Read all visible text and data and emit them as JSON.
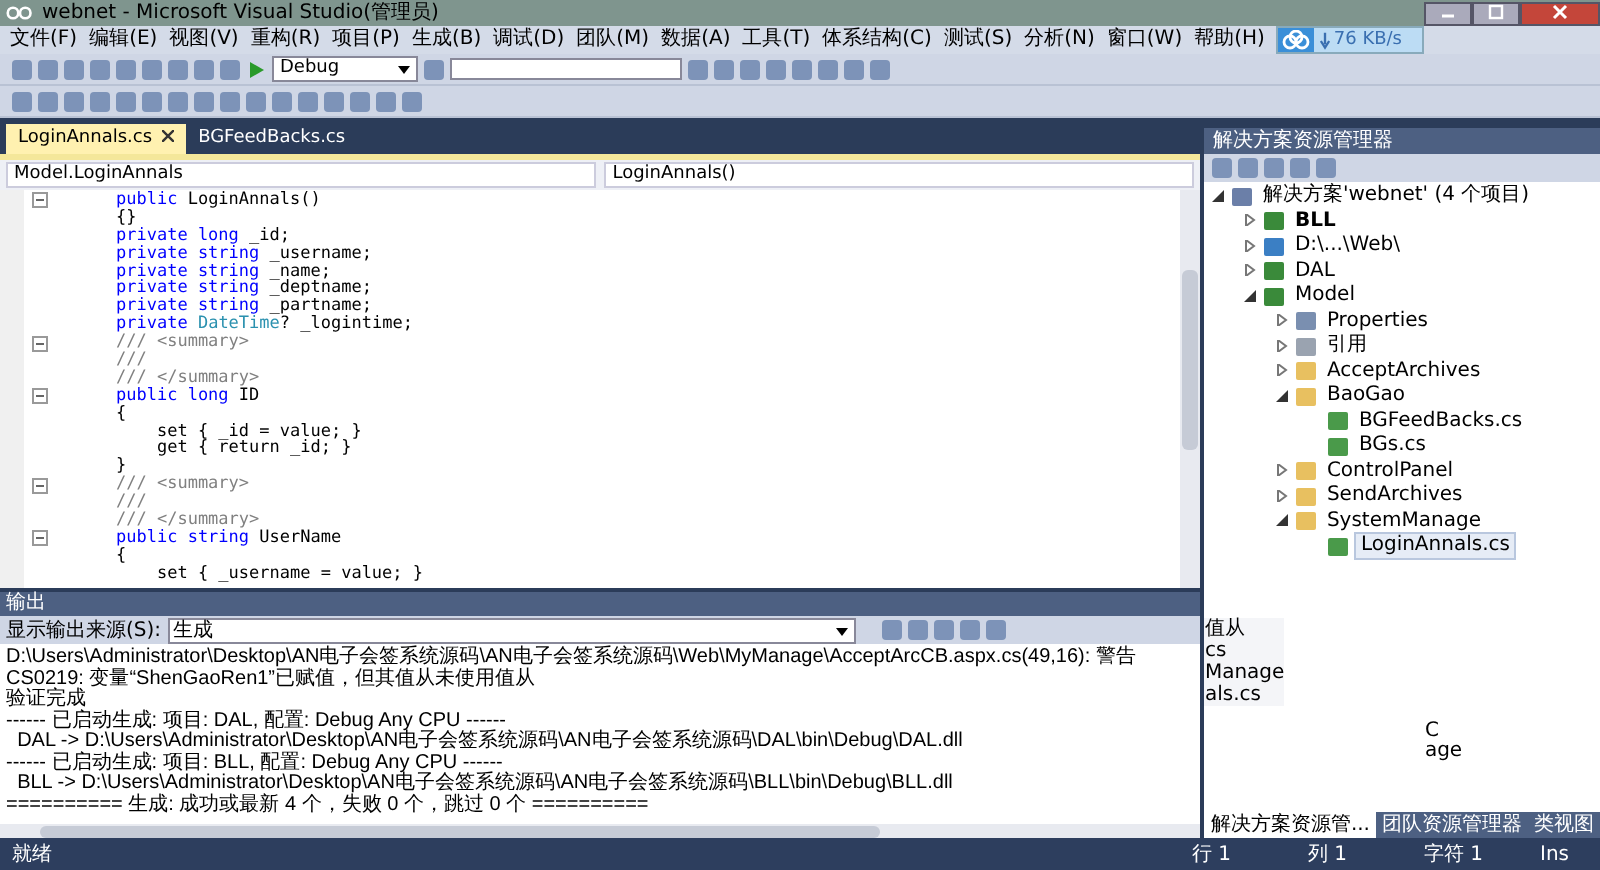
{
  "window": {
    "title": "webnet - Microsoft Visual Studio(管理员)"
  },
  "menu": [
    "文件(F)",
    "编辑(E)",
    "视图(V)",
    "重构(R)",
    "项目(P)",
    "生成(B)",
    "调试(D)",
    "团队(M)",
    "数据(A)",
    "工具(T)",
    "体系结构(C)",
    "测试(S)",
    "分析(N)",
    "窗口(W)",
    "帮助(H)"
  ],
  "network": {
    "speed": "76 KB/s"
  },
  "toolbar": {
    "config": "Debug"
  },
  "tabs": [
    {
      "label": "LoginAnnals.cs",
      "selected": true
    },
    {
      "label": "BGFeedBacks.cs",
      "selected": false
    }
  ],
  "nav": {
    "type": "Model.LoginAnnals",
    "member": "LoginAnnals()"
  },
  "code": [
    {
      "fold": true,
      "tokens": [
        {
          "kind": "keyword",
          "text": "public "
        },
        {
          "kind": "plain",
          "text": "LoginAnnals()"
        }
      ]
    },
    {
      "fold": false,
      "tokens": [
        {
          "kind": "plain",
          "text": "{}"
        }
      ]
    },
    {
      "fold": false,
      "tokens": [
        {
          "kind": "keyword",
          "text": "private long "
        },
        {
          "kind": "plain",
          "text": "_id;"
        }
      ]
    },
    {
      "fold": false,
      "tokens": [
        {
          "kind": "keyword",
          "text": "private string "
        },
        {
          "kind": "plain",
          "text": "_username;"
        }
      ]
    },
    {
      "fold": false,
      "tokens": [
        {
          "kind": "keyword",
          "text": "private string "
        },
        {
          "kind": "plain",
          "text": "_name;"
        }
      ]
    },
    {
      "fold": false,
      "tokens": [
        {
          "kind": "keyword",
          "text": "private string "
        },
        {
          "kind": "plain",
          "text": "_deptname;"
        }
      ]
    },
    {
      "fold": false,
      "tokens": [
        {
          "kind": "keyword",
          "text": "private string "
        },
        {
          "kind": "plain",
          "text": "_partname;"
        }
      ]
    },
    {
      "fold": false,
      "tokens": [
        {
          "kind": "keyword",
          "text": "private "
        },
        {
          "kind": "type",
          "text": "DateTime"
        },
        {
          "kind": "plain",
          "text": "? _logintime;"
        }
      ]
    },
    {
      "fold": true,
      "tokens": [
        {
          "kind": "comment",
          "text": "/// <summary>"
        }
      ]
    },
    {
      "fold": false,
      "tokens": [
        {
          "kind": "comment",
          "text": "///"
        }
      ]
    },
    {
      "fold": false,
      "tokens": [
        {
          "kind": "comment",
          "text": "/// </summary>"
        }
      ]
    },
    {
      "fold": true,
      "tokens": [
        {
          "kind": "keyword",
          "text": "public long "
        },
        {
          "kind": "plain",
          "text": "ID"
        }
      ]
    },
    {
      "fold": false,
      "tokens": [
        {
          "kind": "plain",
          "text": "{"
        }
      ]
    },
    {
      "fold": false,
      "tokens": [
        {
          "kind": "plain",
          "text": "    set { _id = value; }"
        }
      ]
    },
    {
      "fold": false,
      "tokens": [
        {
          "kind": "plain",
          "text": "    get { return _id; }"
        }
      ]
    },
    {
      "fold": false,
      "tokens": [
        {
          "kind": "plain",
          "text": "}"
        }
      ]
    },
    {
      "fold": true,
      "tokens": [
        {
          "kind": "comment",
          "text": "/// <summary>"
        }
      ]
    },
    {
      "fold": false,
      "tokens": [
        {
          "kind": "comment",
          "text": "///"
        }
      ]
    },
    {
      "fold": false,
      "tokens": [
        {
          "kind": "comment",
          "text": "/// </summary>"
        }
      ]
    },
    {
      "fold": true,
      "tokens": [
        {
          "kind": "keyword",
          "text": "public string "
        },
        {
          "kind": "plain",
          "text": "UserName"
        }
      ]
    },
    {
      "fold": false,
      "tokens": [
        {
          "kind": "plain",
          "text": "{"
        }
      ]
    },
    {
      "fold": false,
      "tokens": [
        {
          "kind": "plain",
          "text": "    set { _username = value; }"
        }
      ]
    }
  ],
  "output": {
    "title": "输出",
    "source_label": "显示输出来源(S):",
    "source": "生成",
    "lines": [
      "D:\\Users\\Administrator\\Desktop\\AN电子会签系统源码\\AN电子会签系统源码\\Web\\MyManage\\AcceptArcCB.aspx.cs(49,16): 警告 CS0219: 变量“ShenGaoRen1”已赋值，但其值从未使用值从",
      "验证完成",
      "------ 已启动生成: 项目: DAL, 配置: Debug Any CPU ------",
      "  DAL -> D:\\Users\\Administrator\\Desktop\\AN电子会签系统源码\\AN电子会签系统源码\\DAL\\bin\\Debug\\DAL.dll",
      "------ 已启动生成: 项目: BLL, 配置: Debug Any CPU ------",
      "  BLL -> D:\\Users\\Administrator\\Desktop\\AN电子会签系统源码\\AN电子会签系统源码\\BLL\\bin\\Debug\\BLL.dll",
      "========== 生成: 成功或最新 4 个，失败 0 个，跳过 0 个 =========="
    ]
  },
  "explorer": {
    "title": "解决方案资源管理器",
    "tree": [
      {
        "label": "解决方案'webnet' (4 个项目)",
        "kind": "solution",
        "expanded": true,
        "selected": false,
        "children": [
          {
            "label": "BLL",
            "kind": "project",
            "expanded": false,
            "selected": false,
            "bold": true
          },
          {
            "label": "D:\\...\\Web\\",
            "kind": "web",
            "expanded": false,
            "selected": false
          },
          {
            "label": "DAL",
            "kind": "project",
            "expanded": false,
            "selected": false
          },
          {
            "label": "Model",
            "kind": "project",
            "expanded": true,
            "selected": false,
            "children": [
              {
                "label": "Properties",
                "kind": "properties",
                "expanded": false,
                "selected": false
              },
              {
                "label": "引用",
                "kind": "references",
                "expanded": false,
                "selected": false
              },
              {
                "label": "AcceptArchives",
                "kind": "folder",
                "expanded": false,
                "selected": false
              },
              {
                "label": "BaoGao",
                "kind": "folder",
                "expanded": true,
                "selected": false,
                "children": [
                  {
                    "label": "BGFeedBacks.cs",
                    "kind": "file",
                    "selected": false
                  },
                  {
                    "label": "BGs.cs",
                    "kind": "file",
                    "selected": false
                  }
                ]
              },
              {
                "label": "ControlPanel",
                "kind": "folder",
                "expanded": false,
                "selected": false
              },
              {
                "label": "SendArchives",
                "kind": "folder",
                "expanded": false,
                "selected": false
              },
              {
                "label": "SystemManage",
                "kind": "folder",
                "expanded": true,
                "selected": false,
                "children": [
                  {
                    "label": "LoginAnnals.cs",
                    "kind": "file",
                    "selected": true
                  }
                ]
              }
            ]
          }
        ]
      }
    ],
    "ghost_texts": [
      "值从",
      "cs",
      "Manage",
      "als.cs"
    ],
    "lower_ghost": [
      "C",
      "age"
    ],
    "bottom_tabs": [
      {
        "label": "解决方案资源管...",
        "selected": true
      },
      {
        "label": "团队资源管理器",
        "selected": false
      },
      {
        "label": "类视图",
        "selected": false
      }
    ]
  },
  "status_bar": {
    "message": "就绪",
    "line": "行 1",
    "col": "列 1",
    "char": "字符 1",
    "mode": "Ins"
  }
}
